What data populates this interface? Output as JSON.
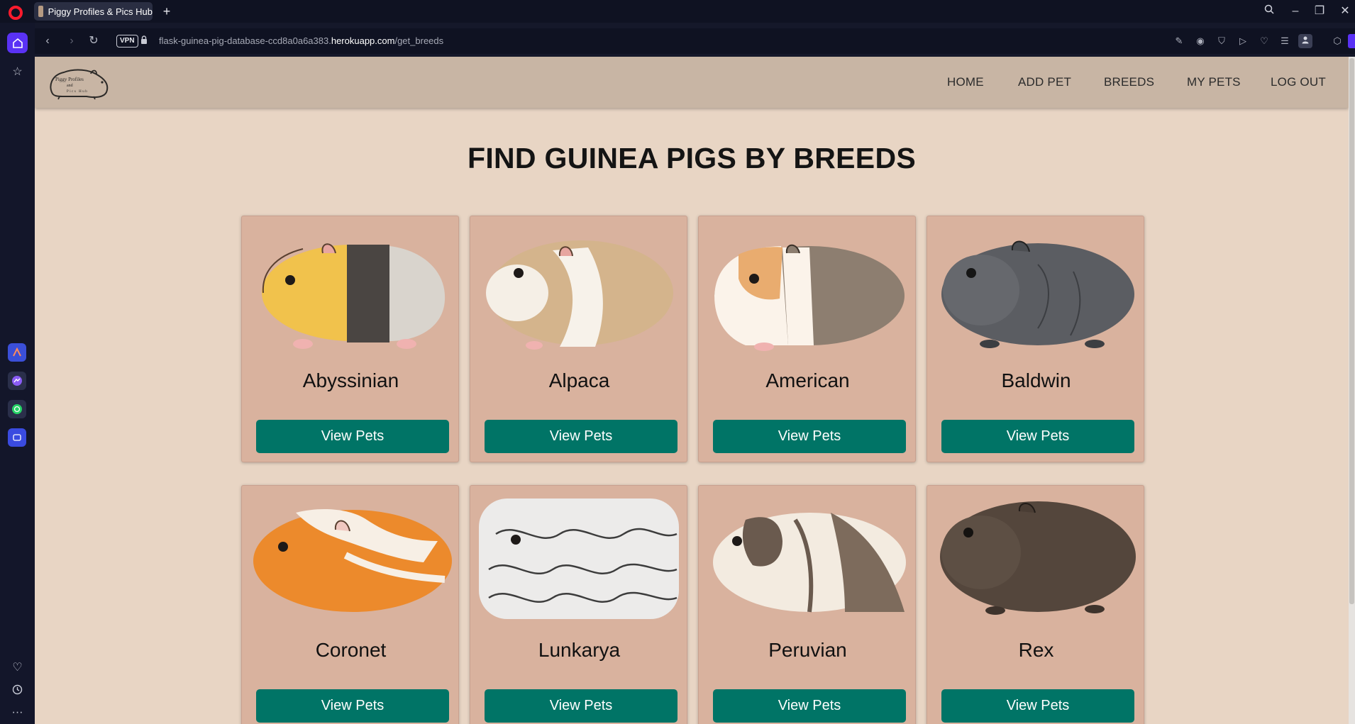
{
  "browser": {
    "tab_title": "Piggy Profiles & Pics Hub",
    "url": {
      "prefix": "flask-guinea-pig-database-ccd8a0a6a383.",
      "host": "herokuapp.com",
      "path": "/get_breeds"
    },
    "vpn_label": "VPN",
    "accent_color": "#5a32f5"
  },
  "site": {
    "logo_text_line1": "Piggy Profiles",
    "logo_text_line2": "and",
    "logo_text_line3": "Pics Hub",
    "nav": [
      "HOME",
      "ADD PET",
      "BREEDS",
      "MY PETS",
      "LOG OUT"
    ],
    "page_title": "FIND GUINEA PIGS BY BREEDS",
    "button_color": "#007466",
    "card_color": "#d9b29e",
    "background_color": "#e8d5c4"
  },
  "breeds": [
    {
      "name": "Abyssinian",
      "button": "View Pets",
      "image_icon": "abyssinian-guinea-pig-illustration"
    },
    {
      "name": "Alpaca",
      "button": "View Pets",
      "image_icon": "alpaca-guinea-pig-illustration"
    },
    {
      "name": "American",
      "button": "View Pets",
      "image_icon": "american-guinea-pig-illustration"
    },
    {
      "name": "Baldwin",
      "button": "View Pets",
      "image_icon": "baldwin-guinea-pig-illustration"
    },
    {
      "name": "Coronet",
      "button": "View Pets",
      "image_icon": "coronet-guinea-pig-illustration"
    },
    {
      "name": "Lunkarya",
      "button": "View Pets",
      "image_icon": "lunkarya-guinea-pig-illustration"
    },
    {
      "name": "Peruvian",
      "button": "View Pets",
      "image_icon": "peruvian-guinea-pig-illustration"
    },
    {
      "name": "Rex",
      "button": "View Pets",
      "image_icon": "rex-guinea-pig-illustration"
    }
  ]
}
